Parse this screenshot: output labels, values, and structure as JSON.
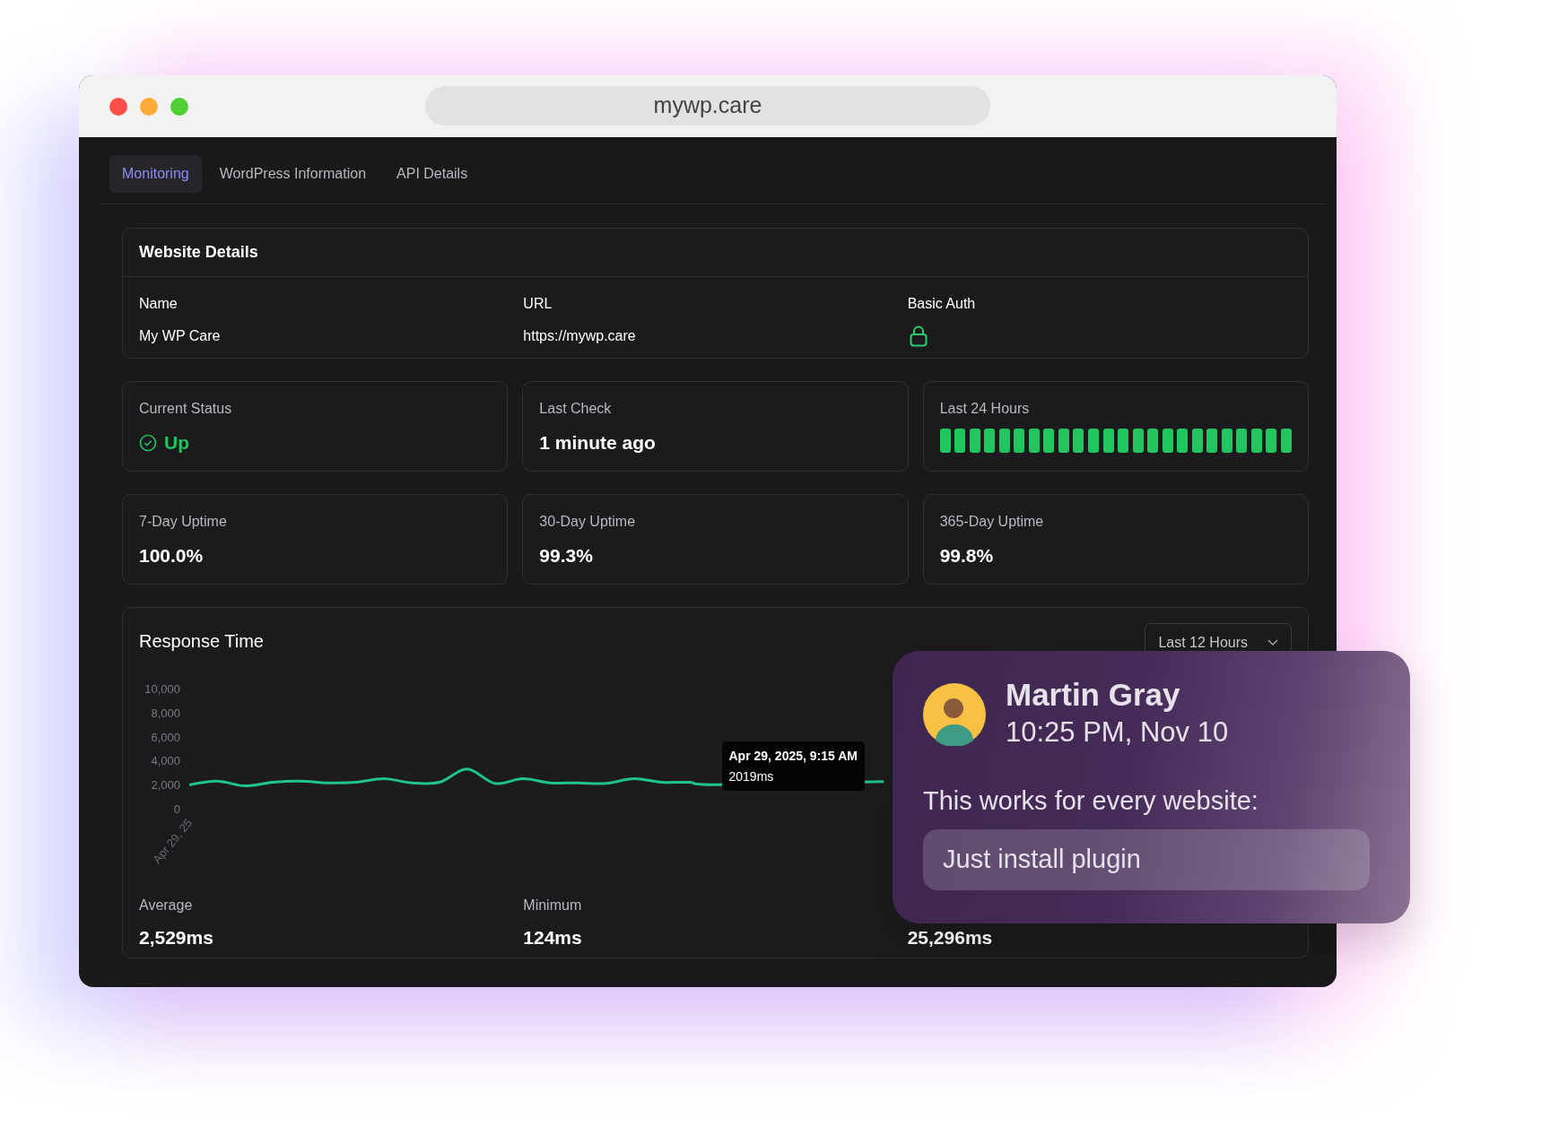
{
  "browser": {
    "address": "mywp.care"
  },
  "tabs": [
    {
      "label": "Monitoring",
      "selected": true
    },
    {
      "label": "WordPress Information",
      "selected": false
    },
    {
      "label": "API Details",
      "selected": false
    }
  ],
  "website_details": {
    "title": "Website Details",
    "fields": [
      {
        "label": "Name",
        "kind": "text",
        "value": "My WP Care"
      },
      {
        "label": "URL",
        "kind": "text",
        "value": "https://mywp.care"
      },
      {
        "label": "Basic Auth",
        "kind": "lock"
      }
    ]
  },
  "status_cards": [
    {
      "label": "Current Status",
      "kind": "status",
      "value": "Up"
    },
    {
      "label": "Last Check",
      "kind": "text",
      "value": "1 minute ago"
    },
    {
      "label": "Last 24 Hours",
      "kind": "bars",
      "hours": [
        {
          "up": true
        },
        {
          "up": true
        },
        {
          "up": true
        },
        {
          "up": true
        },
        {
          "up": true
        },
        {
          "up": true
        },
        {
          "up": true
        },
        {
          "up": true
        },
        {
          "up": true
        },
        {
          "up": true
        },
        {
          "up": true
        },
        {
          "up": true
        },
        {
          "up": true
        },
        {
          "up": true
        },
        {
          "up": true
        },
        {
          "up": true
        },
        {
          "up": true
        },
        {
          "up": true
        },
        {
          "up": true
        },
        {
          "up": true
        },
        {
          "up": true
        },
        {
          "up": true
        },
        {
          "up": true
        },
        {
          "up": true
        }
      ]
    }
  ],
  "uptime_cards": [
    {
      "label": "7-Day Uptime",
      "value": "100.0%"
    },
    {
      "label": "30-Day Uptime",
      "value": "99.3%"
    },
    {
      "label": "365-Day Uptime",
      "value": "99.8%"
    }
  ],
  "response_time": {
    "title": "Response Time",
    "range_select": "Last 12 Hours",
    "chart_data": {
      "type": "line",
      "series": [
        {
          "color": "#1fc58a",
          "values": [
            2000,
            2300,
            1900,
            2200,
            2300,
            2150,
            2200,
            2500,
            2150,
            2200,
            3300,
            2100,
            2500,
            2150,
            2150,
            2100,
            2500,
            2200,
            2200,
            2000,
            null,
            null,
            null,
            null,
            null,
            2250
          ]
        }
      ],
      "ylim": [
        0,
        10000
      ],
      "yticks": [
        {
          "value": 0,
          "label": "0"
        },
        {
          "value": 2000,
          "label": "2,000"
        },
        {
          "value": 4000,
          "label": "4,000"
        },
        {
          "value": 6000,
          "label": "6,000"
        },
        {
          "value": 8000,
          "label": "8,000"
        },
        {
          "value": 10000,
          "label": "10,000"
        }
      ],
      "annotations": [
        {
          "text": "Apr 29, 25"
        }
      ]
    },
    "tooltip": {
      "title": "Apr 29, 2025, 9:15 AM",
      "value": "2019ms"
    },
    "stats": [
      {
        "label": "Average",
        "value": "2,529ms"
      },
      {
        "label": "Minimum",
        "value": "124ms"
      },
      {
        "value": "25,296ms"
      }
    ]
  },
  "notification": {
    "name": "Martin Gray",
    "time": "10:25 PM, Nov 10",
    "message": "This works for every website:",
    "highlight": "Just install plugin"
  }
}
